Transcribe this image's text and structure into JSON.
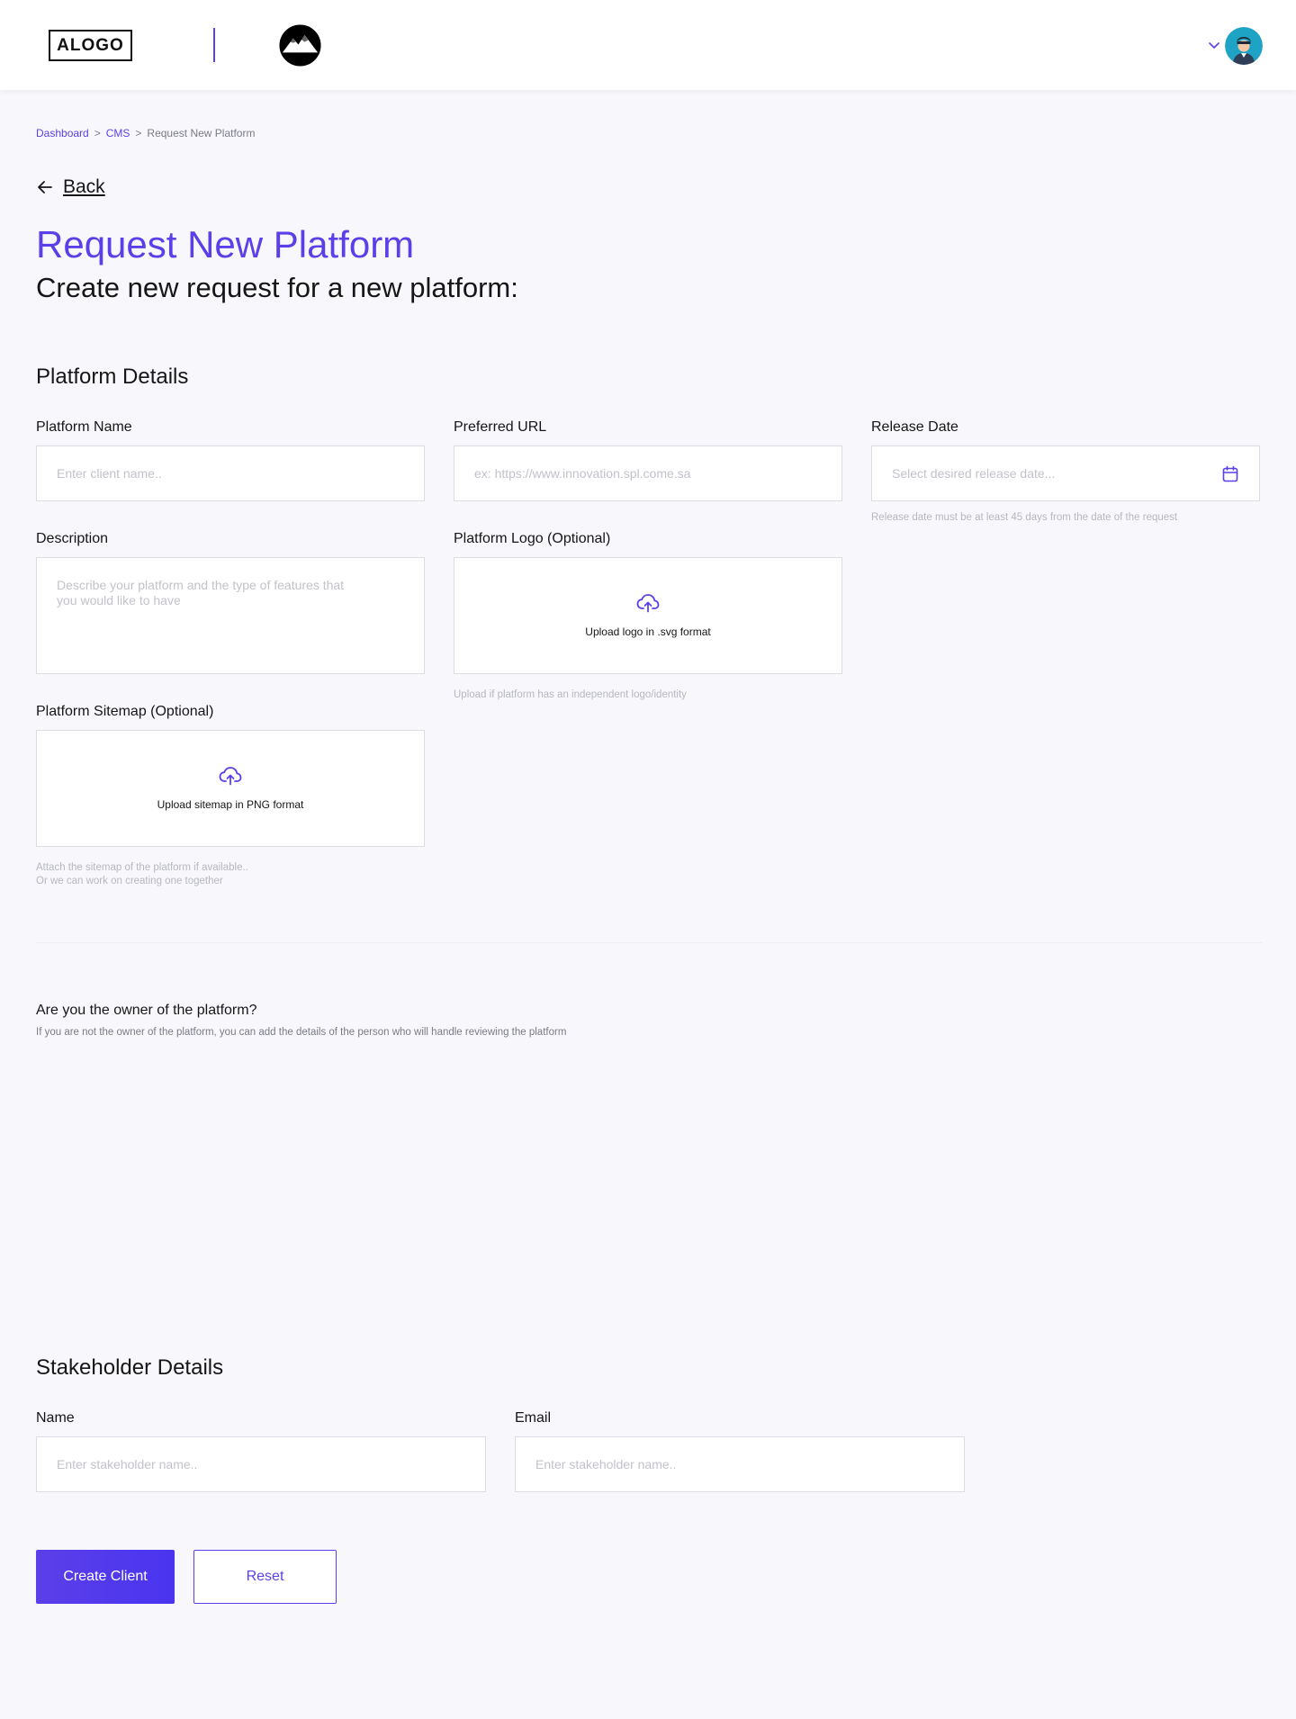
{
  "header": {
    "logo_text": "ALOGO"
  },
  "breadcrumb": {
    "items": [
      "Dashboard",
      "CMS",
      "Request New Platform"
    ],
    "separator": ">"
  },
  "back_label": "Back",
  "page": {
    "title": "Request New Platform",
    "subtitle": "Create new request for a new platform:"
  },
  "platform_details": {
    "section_title": "Platform Details",
    "platform_name": {
      "label": "Platform Name",
      "placeholder": "Enter client name.."
    },
    "preferred_url": {
      "label": "Preferred URL",
      "placeholder": "ex: https://www.innovation.spl.come.sa"
    },
    "release_date": {
      "label": "Release Date",
      "placeholder": "Select desired release date...",
      "helper": "Release date must be at least 45 days from the date of the request"
    },
    "description": {
      "label": "Description",
      "placeholder": "Describe your platform and the type of features that you would like to have"
    },
    "logo": {
      "label": "Platform Logo (Optional)",
      "upload_text": "Upload logo in .svg format",
      "helper": "Upload if platform has an independent logo/identity"
    },
    "sitemap": {
      "label": "Platform Sitemap (Optional)",
      "upload_text": "Upload sitemap in PNG format",
      "helper_line1": "Attach the sitemap of the platform if available..",
      "helper_line2": "Or we can work on creating one together"
    }
  },
  "owner": {
    "question": "Are you the owner of the platform?",
    "note": "If you are not the owner of the platform, you can add the details of the person who will handle reviewing the platform"
  },
  "stakeholder": {
    "section_title": "Stakeholder Details",
    "name": {
      "label": "Name",
      "placeholder": "Enter stakeholder name.."
    },
    "email": {
      "label": "Email",
      "placeholder": "Enter stakeholder name.."
    }
  },
  "actions": {
    "primary": "Create Client",
    "secondary": "Reset"
  },
  "colors": {
    "accent": "#5b3fe8",
    "background": "#f8f8fc",
    "avatar_bg": "#1fa3c4"
  },
  "icons": {
    "back": "arrow-left-icon",
    "calendar": "calendar-icon",
    "upload": "cloud-upload-icon",
    "chevron": "chevron-down-icon"
  }
}
